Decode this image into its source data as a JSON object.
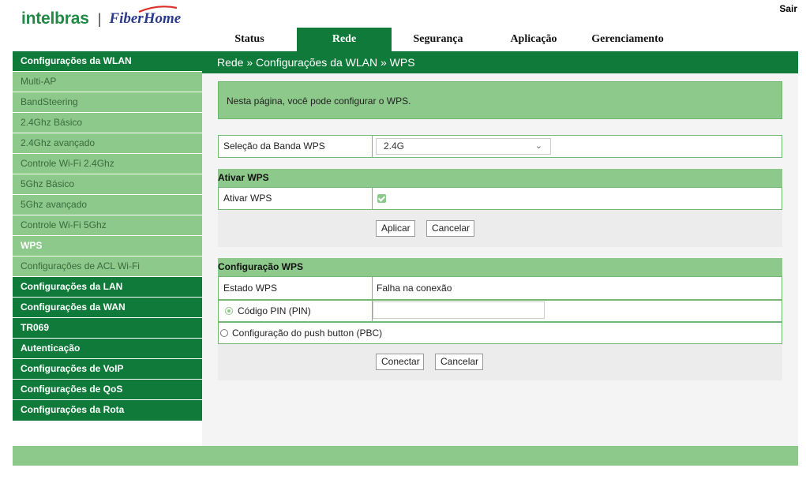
{
  "brand": {
    "left": "intelbras",
    "separator": "|",
    "right": "FiberHome"
  },
  "logout_label": "Sair",
  "topnav": [
    {
      "label": "Status"
    },
    {
      "label": "Rede"
    },
    {
      "label": "Segurança"
    },
    {
      "label": "Aplicação"
    },
    {
      "label": "Gerenciamento"
    }
  ],
  "sidebar": {
    "wlan_header": "Configurações da WLAN",
    "wlan_items": [
      "Multi-AP",
      "BandSteering",
      "2.4Ghz Básico",
      "2.4Ghz avançado",
      "Controle Wi-Fi 2.4Ghz",
      "5Ghz Básico",
      "5Ghz avançado",
      "Controle Wi-Fi 5Ghz",
      "WPS",
      "Configurações de ACL Wi-Fi"
    ],
    "sections": [
      "Configurações da LAN",
      "Configurações da WAN",
      "TR069",
      "Autenticação",
      "Configurações de VoIP",
      "Configurações de QoS",
      "Configurações da Rota"
    ]
  },
  "breadcrumb": "Rede » Configurações da WLAN » WPS",
  "description": "Nesta página, você pode configurar o WPS.",
  "band": {
    "label": "Seleção da Banda WPS",
    "value": "2.4G"
  },
  "activate": {
    "header": "Ativar WPS",
    "label": "Ativar WPS",
    "checked": true,
    "apply_label": "Aplicar",
    "cancel_label": "Cancelar"
  },
  "config": {
    "header": "Configuração WPS",
    "state_label": "Estado WPS",
    "state_value": "Falha na conexão",
    "pin_label": "Código PIN (PIN)",
    "pin_value": "",
    "pbc_label": "Configuração do push button (PBC)",
    "connect_label": "Conectar",
    "cancel_label": "Cancelar"
  },
  "colors": {
    "dark_green": "#107a3a",
    "light_green": "#8dc98a"
  }
}
